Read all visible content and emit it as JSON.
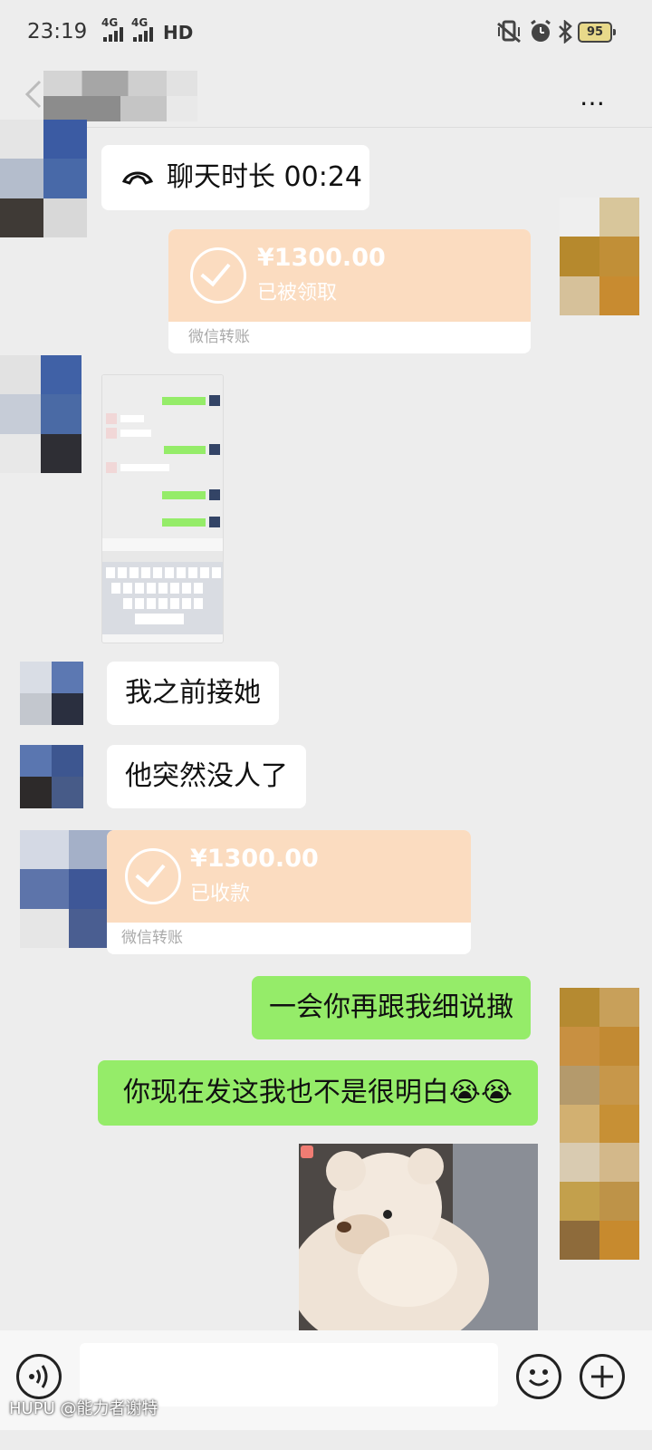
{
  "status_bar": {
    "time": "23:19",
    "net1": "4G",
    "net2": "4G",
    "hd": "HD",
    "battery": "95"
  },
  "title_bar": {
    "more": "…"
  },
  "messages": {
    "call_duration": "聊天时长 00:24",
    "transfer1_amount": "¥1300.00",
    "transfer1_status": "已被领取",
    "transfer_label": "微信转账",
    "msg1": "我之前接她",
    "msg2": "他突然没人了",
    "transfer2_amount": "¥1300.00",
    "transfer2_status": "已收款",
    "msg3": "一会你再跟我细说撖",
    "msg4": "你现在发这我也不是很明白😭😭"
  },
  "watermark": "HUPU @能力者谢特"
}
